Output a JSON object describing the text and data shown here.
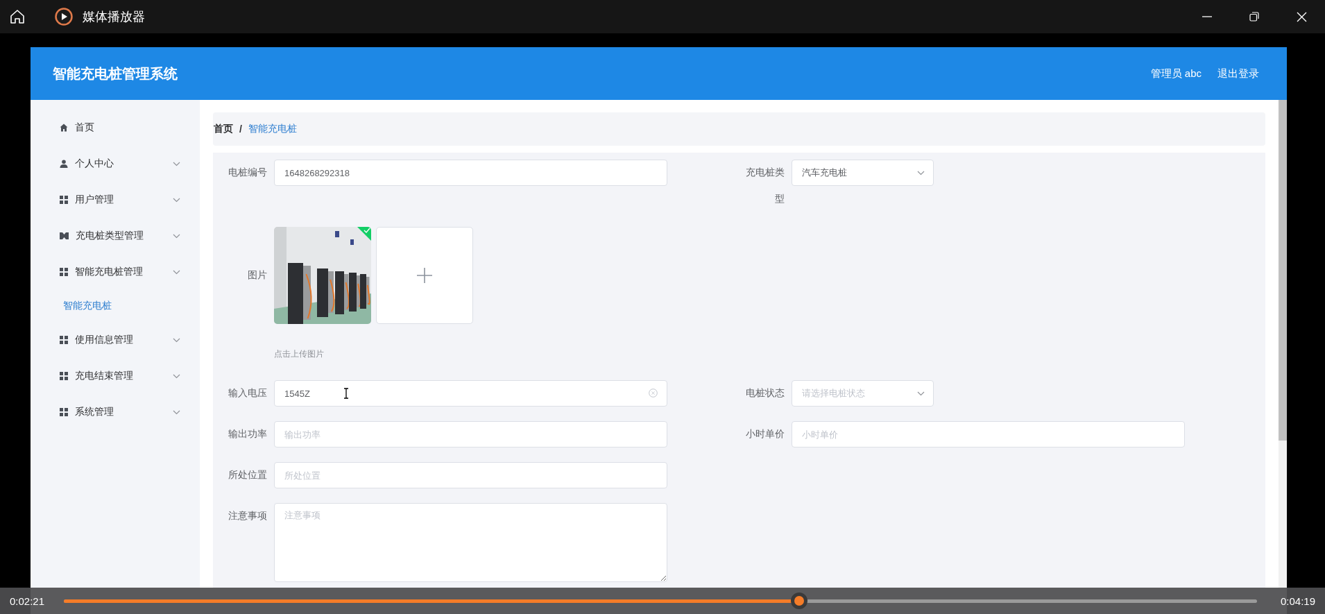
{
  "player": {
    "title": "媒体播放器",
    "current_time": "0:02:21",
    "total_time": "0:04:19",
    "progress": {
      "level": 0.616
    }
  },
  "app": {
    "title": "智能充电桩管理系统",
    "user": "管理员 abc",
    "logout": "退出登录"
  },
  "sidebar": {
    "items": [
      {
        "label": "首页",
        "kind": "link"
      },
      {
        "label": "个人中心",
        "kind": "submenu"
      },
      {
        "label": "用户管理",
        "kind": "submenu"
      },
      {
        "label": "充电桩类型管理",
        "kind": "submenu"
      },
      {
        "label": "智能充电桩管理",
        "kind": "submenu",
        "children": [
          {
            "label": "智能充电桩",
            "selected": true
          }
        ]
      },
      {
        "label": "使用信息管理",
        "kind": "submenu"
      },
      {
        "label": "充电结束管理",
        "kind": "submenu"
      },
      {
        "label": "系统管理",
        "kind": "submenu"
      }
    ]
  },
  "breadcrumb": {
    "separator": "/",
    "items": [
      {
        "label": "首页",
        "selected": false
      },
      {
        "label": "智能充电桩",
        "selected": true
      }
    ]
  },
  "form": {
    "rows": [
      {
        "left": {
          "label": "电桩编号",
          "kind": "input",
          "value": "1648268292318"
        },
        "right": {
          "label": "充电桩类型",
          "kind": "select",
          "value": "汽车充电桩"
        }
      },
      {
        "left": {
          "label": "图片",
          "kind": "upload",
          "hint": "点击上传图片",
          "files": [
            {
              "kind": "picture",
              "success": true
            }
          ]
        }
      },
      {
        "left": {
          "label": "输入电压",
          "kind": "input",
          "value": "1545Z",
          "clearable": true
        },
        "right": {
          "label": "电桩状态",
          "kind": "select",
          "placeholder": "请选择电桩状态"
        }
      },
      {
        "left": {
          "label": "输出功率",
          "kind": "input",
          "placeholder": "输出功率"
        },
        "right": {
          "label": "小时单价",
          "kind": "input",
          "placeholder": "小时单价"
        }
      },
      {
        "left": {
          "label": "所处位置",
          "kind": "input",
          "placeholder": "所处位置"
        }
      },
      {
        "left": {
          "label": "注意事项",
          "kind": "textarea",
          "placeholder": "注意事项"
        }
      }
    ]
  }
}
